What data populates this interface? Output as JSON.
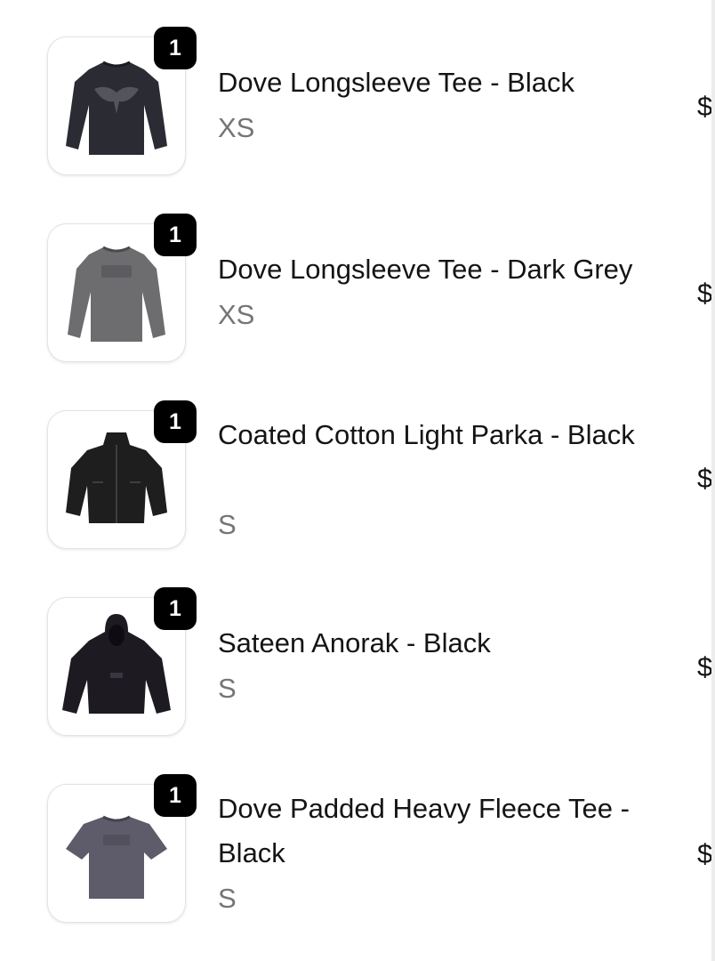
{
  "items": [
    {
      "quantity": "1",
      "title": "Dove Longsleeve Tee - Black",
      "variant": "XS",
      "price": "$",
      "image_icon": "black-longsleeve-tee-icon"
    },
    {
      "quantity": "1",
      "title": "Dove Longsleeve Tee - Dark Grey",
      "variant": "XS",
      "price": "$",
      "image_icon": "dark-grey-longsleeve-tee-icon"
    },
    {
      "quantity": "1",
      "title": "Coated Cotton Light Parka - Black",
      "variant": "S",
      "price": "$",
      "image_icon": "black-parka-icon"
    },
    {
      "quantity": "1",
      "title": "Sateen Anorak - Black",
      "variant": "S",
      "price": "$",
      "image_icon": "black-anorak-icon"
    },
    {
      "quantity": "1",
      "title": "Dove Padded Heavy Fleece Tee - Black",
      "variant": "S",
      "price": "$",
      "image_icon": "grey-tshirt-icon"
    }
  ],
  "colors": {
    "badge": "#000000",
    "title": "#141414",
    "variant": "#757575"
  }
}
